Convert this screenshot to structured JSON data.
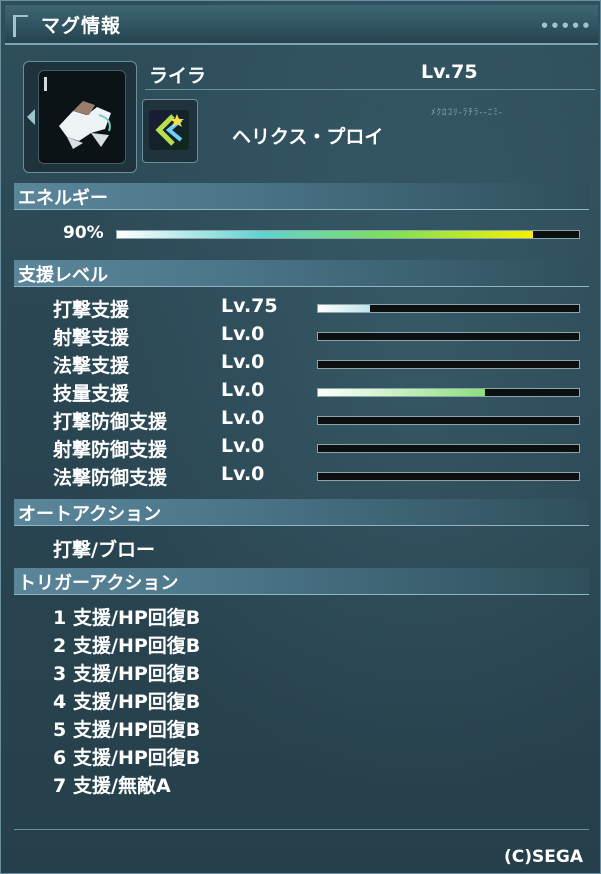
{
  "window": {
    "title": "マグ情報"
  },
  "mag": {
    "name": "ライラ",
    "level": "Lv.75",
    "photon_blast": "ヘリクス・プロイ",
    "code_text": "ﾒｸﾛｺﾘ-ﾗﾁﾗ--ﾆﾐ-"
  },
  "energy": {
    "header": "エネルギー",
    "percent_label": "90%",
    "fraction": 0.9
  },
  "support": {
    "header": "支援レベル",
    "rows": [
      {
        "label": "打撃支援",
        "level": "Lv.75",
        "fill": 0.2,
        "color": "#bfe4ea"
      },
      {
        "label": "射撃支援",
        "level": "Lv.0",
        "fill": 0,
        "color": "#bfe4ea"
      },
      {
        "label": "法撃支援",
        "level": "Lv.0",
        "fill": 0,
        "color": "#bfe4ea"
      },
      {
        "label": "技量支援",
        "level": "Lv.0",
        "fill": 0.64,
        "color": "#8be07a"
      },
      {
        "label": "打撃防御支援",
        "level": "Lv.0",
        "fill": 0,
        "color": "#bfe4ea"
      },
      {
        "label": "射撃防御支援",
        "level": "Lv.0",
        "fill": 0,
        "color": "#bfe4ea"
      },
      {
        "label": "法撃防御支援",
        "level": "Lv.0",
        "fill": 0,
        "color": "#bfe4ea"
      }
    ]
  },
  "auto_action": {
    "header": "オートアクション",
    "value": "打撃/ブロー"
  },
  "trigger_action": {
    "header": "トリガーアクション",
    "items": [
      {
        "num": "1",
        "text": "支援/HP回復B"
      },
      {
        "num": "2",
        "text": "支援/HP回復B"
      },
      {
        "num": "3",
        "text": "支援/HP回復B"
      },
      {
        "num": "4",
        "text": "支援/HP回復B"
      },
      {
        "num": "5",
        "text": "支援/HP回復B"
      },
      {
        "num": "6",
        "text": "支援/HP回復B"
      },
      {
        "num": "7",
        "text": "支援/無敵A"
      }
    ]
  },
  "footer": {
    "copyright": "(C)SEGA"
  },
  "icons": {
    "mag": "mag-icon",
    "photon_blast": "photon-blast-icon"
  },
  "colors": {
    "accent": "#5b869a",
    "energy_start": "#ffffff",
    "energy_mid": "#5fd3d0",
    "energy_end": "#f5f000"
  }
}
